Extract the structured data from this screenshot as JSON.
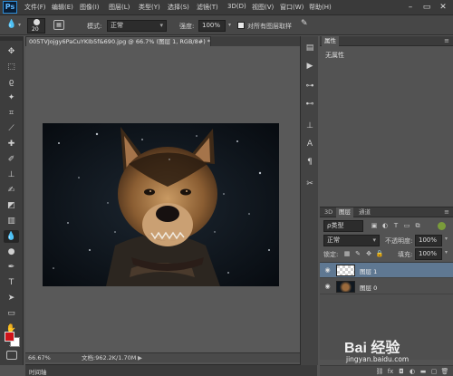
{
  "app": {
    "logo_text": "Ps"
  },
  "menu": [
    "文件(F)",
    "编辑(E)",
    "图像(I)",
    "图层(L)",
    "类型(Y)",
    "选择(S)",
    "滤镜(T)",
    "3D(D)",
    "视图(V)",
    "窗口(W)",
    "帮助(H)"
  ],
  "window_controls": {
    "minimize": "–",
    "maximize": "▭",
    "close": "✕"
  },
  "options": {
    "brush_size": "20",
    "mode_label": "模式:",
    "mode_value": "正常",
    "strength_label": "强度:",
    "strength_value": "100%",
    "sample_all_label": "对所有图层取样"
  },
  "document": {
    "tab_title": "005TVJojgy6PaCuYKIb5f&690.jpg @ 66.7% (图层 1, RGB/8#) *",
    "tab_close": "×"
  },
  "status": {
    "zoom": "66.67%",
    "doc_info": "文档:962.2K/1.70M",
    "arrow": "▶"
  },
  "timeline": {
    "label": "时间轴"
  },
  "properties": {
    "tab_label": "属性",
    "content": "无属性"
  },
  "layers": {
    "tabs": [
      "3D",
      "图层",
      "通道"
    ],
    "filter_label": "ρ类型",
    "blend_mode": "正常",
    "opacity_label": "不透明度:",
    "opacity_value": "100%",
    "lock_label": "锁定:",
    "fill_label": "填充:",
    "fill_value": "100%",
    "items": [
      {
        "name": "图层 1",
        "selected": true
      },
      {
        "name": "图层 0",
        "selected": false
      }
    ]
  },
  "watermark": {
    "brand": "Bai 经验",
    "url": "jingyan.baidu.com"
  },
  "colors": {
    "accent_selection": "#5f7892",
    "foreground_swatch": "#d0141a",
    "background_swatch": "#ffffff"
  }
}
